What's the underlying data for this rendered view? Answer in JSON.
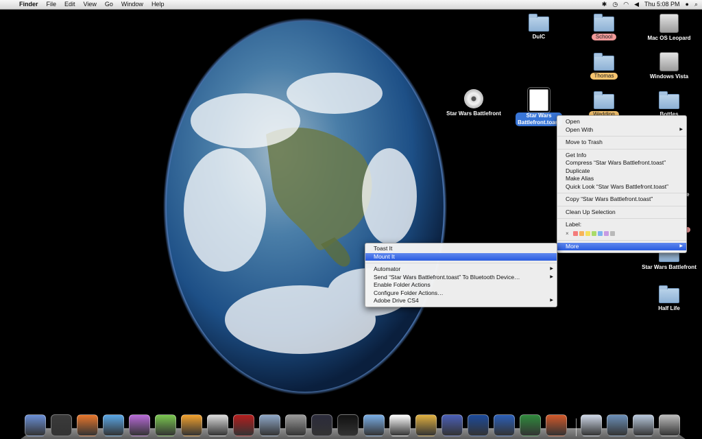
{
  "menubar": {
    "app": "Finder",
    "items": [
      "File",
      "Edit",
      "View",
      "Go",
      "Window",
      "Help"
    ],
    "clock": "Thu 5:08 PM"
  },
  "desktop": {
    "icons": {
      "dulc": "DulC",
      "school": "School",
      "mac_os": "Mac OS Leopard",
      "thomas": "Thomas",
      "windows_vista": "Windows Vista",
      "wedding": "Wedding",
      "bottles": "Bottles",
      "cd_swbf": "Star Wars Battlefront",
      "toast_file_l1": "Star Wars",
      "toast_file_l2": "Battlefront.toast",
      "swbf_folder": "Star Wars Battlefront",
      "half_life": "Half Life",
      "partial_e": "e"
    }
  },
  "context_menu": {
    "open": "Open",
    "open_with": "Open With",
    "move_to_trash": "Move to Trash",
    "get_info": "Get Info",
    "compress": "Compress “Star Wars Battlefront.toast”",
    "duplicate": "Duplicate",
    "make_alias": "Make Alias",
    "quick_look": "Quick Look “Star Wars Battlefront.toast”",
    "copy": "Copy “Star Wars Battlefront.toast”",
    "clean_up": "Clean Up Selection",
    "label": "Label:",
    "label_none": "×",
    "more": "More"
  },
  "submenu": {
    "toast_it": "Toast It",
    "mount_it": "Mount It",
    "automator": "Automator",
    "send_bt": "Send “Star Wars Battlefront.toast” To Bluetooth Device…",
    "enable_fa": "Enable Folder Actions",
    "configure_fa": "Configure Folder Actions…",
    "adobe_drive": "Adobe Drive CS4"
  },
  "label_colors": [
    "#f47c7c",
    "#f7b35a",
    "#f5e05a",
    "#a9db6a",
    "#7fb3f0",
    "#c79be3",
    "#b9b9b9"
  ],
  "dock_icons": [
    "finder-icon",
    "dashboard-icon",
    "firefox-icon",
    "itunes-icon",
    "wiki-icon",
    "network-icon",
    "pipes-icon",
    "textedit-icon",
    "photo-booth-icon",
    "mail-icon",
    "system-prefs-icon",
    "stellarium-icon",
    "steam-icon",
    "appstore-icon",
    "7zip-icon",
    "toast-icon",
    "mb-icon",
    "aol-icon",
    "word-icon",
    "excel-icon",
    "powerpoint-icon",
    "movie-icon",
    "documents-stack-icon",
    "downloads-stack-icon",
    "trash-icon"
  ]
}
